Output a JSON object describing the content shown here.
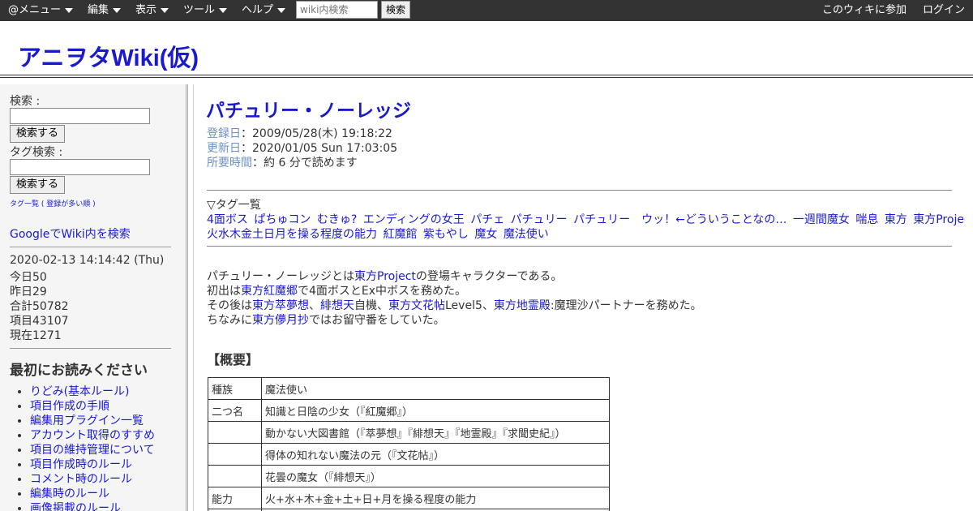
{
  "topbar": {
    "menus": [
      {
        "label": "@メニュー"
      },
      {
        "label": "編集"
      },
      {
        "label": "表示"
      },
      {
        "label": "ツール"
      },
      {
        "label": "ヘルプ"
      }
    ],
    "search_placeholder": "wiki内検索",
    "search_button": "検索",
    "join": "このウィキに参加",
    "login": "ログイン"
  },
  "header": {
    "title": "アニヲタWiki(仮)"
  },
  "sidebar": {
    "search_label": "検索 :",
    "search_button": "検索する",
    "tag_search_label": "タグ検索 :",
    "tag_search_button": "検索する",
    "tag_list_link": "タグ一覧 ( 登録が多い順 )",
    "google_search": "GoogleでWiki内を検索",
    "stats": {
      "datetime": "2020-02-13 14:14:42 (Thu)",
      "today": "今日50",
      "yesterday": "昨日29",
      "total": "合計50782",
      "items": "項目43107",
      "current": "現在1271"
    },
    "read_first_heading": "最初にお読みください",
    "read_first_items": [
      "りどみ(基本ルール)",
      "項目作成の手順",
      "編集用プラグイン一覧",
      "アカウント取得のすすめ",
      "項目の維持管理について",
      "項目作成時のルール",
      "コメント時のルール",
      "編集時のルール",
      "画像掲載のルール"
    ]
  },
  "main": {
    "title": "パチュリー・ノーレッジ",
    "meta": {
      "registered_label": "登録日",
      "registered_value": "：2009/05/28(木) 19:18:22",
      "updated_label": "更新日",
      "updated_value": "：2020/01/05 Sun 17:03:05",
      "read_time_label": "所要時間",
      "read_time_value": "：約 6 分で読めます"
    },
    "tag_heading": "▽タグ一覧",
    "tags_line1": [
      "4面ボス",
      "ぱちゅコン",
      "むきゅ?",
      "エンディングの女王",
      "パチェ",
      "パチュリー",
      "パチュリー　ウッ！←どういうことなの…",
      "一週間魔女",
      "喘息",
      "東方",
      "東方Project"
    ],
    "tags_line2": [
      "火水木金土日月を操る程度の能力",
      "紅魔館",
      "紫もやし",
      "魔女",
      "魔法使い"
    ],
    "intro": {
      "p1_a": "パチュリー・ノーレッジとは",
      "p1_link": "東方Project",
      "p1_b": "の登場キャラクターである。",
      "p2_a": "初出は",
      "p2_link": "東方紅魔郷",
      "p2_b": "で4面ボスとEx中ボスを務めた。",
      "p3_a": "その後は",
      "p3_link1": "東方萃夢想",
      "p3_sep1": "、",
      "p3_link2": "緋想天",
      "p3_b": "自機、",
      "p3_link3": "東方文花帖",
      "p3_c": "Level5、",
      "p3_link4": "東方地霊殿",
      "p3_d": ":魔理沙パートナーを務めた。",
      "p4_a": "ちなみに",
      "p4_link": "東方儚月抄",
      "p4_b": "ではお留守番をしていた。"
    },
    "overview_heading": "【概要】",
    "table": [
      [
        "種族",
        "魔法使い"
      ],
      [
        "二つ名",
        "知識と日陰の少女（『紅魔郷』）"
      ],
      [
        "",
        "動かない大図書館（『萃夢想』『緋想天』『地霊殿』『求聞史紀』）"
      ],
      [
        "",
        "得体の知れない魔法の元（『文花帖』）"
      ],
      [
        "",
        "花曇の魔女（『緋想天』）"
      ],
      [
        "能力",
        "火+水+木+金+土+日+月を操る程度の能力"
      ],
      [
        "",
        ""
      ]
    ]
  }
}
